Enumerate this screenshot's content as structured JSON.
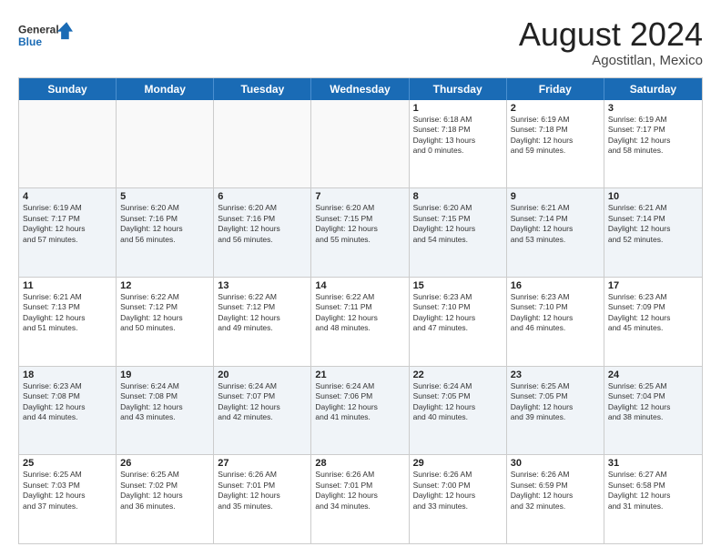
{
  "header": {
    "logo_general": "General",
    "logo_blue": "Blue",
    "month_year": "August 2024",
    "location": "Agostitlan, Mexico"
  },
  "days_of_week": [
    "Sunday",
    "Monday",
    "Tuesday",
    "Wednesday",
    "Thursday",
    "Friday",
    "Saturday"
  ],
  "weeks": [
    [
      {
        "day": "",
        "info": ""
      },
      {
        "day": "",
        "info": ""
      },
      {
        "day": "",
        "info": ""
      },
      {
        "day": "",
        "info": ""
      },
      {
        "day": "1",
        "info": "Sunrise: 6:18 AM\nSunset: 7:18 PM\nDaylight: 13 hours\nand 0 minutes."
      },
      {
        "day": "2",
        "info": "Sunrise: 6:19 AM\nSunset: 7:18 PM\nDaylight: 12 hours\nand 59 minutes."
      },
      {
        "day": "3",
        "info": "Sunrise: 6:19 AM\nSunset: 7:17 PM\nDaylight: 12 hours\nand 58 minutes."
      }
    ],
    [
      {
        "day": "4",
        "info": "Sunrise: 6:19 AM\nSunset: 7:17 PM\nDaylight: 12 hours\nand 57 minutes."
      },
      {
        "day": "5",
        "info": "Sunrise: 6:20 AM\nSunset: 7:16 PM\nDaylight: 12 hours\nand 56 minutes."
      },
      {
        "day": "6",
        "info": "Sunrise: 6:20 AM\nSunset: 7:16 PM\nDaylight: 12 hours\nand 56 minutes."
      },
      {
        "day": "7",
        "info": "Sunrise: 6:20 AM\nSunset: 7:15 PM\nDaylight: 12 hours\nand 55 minutes."
      },
      {
        "day": "8",
        "info": "Sunrise: 6:20 AM\nSunset: 7:15 PM\nDaylight: 12 hours\nand 54 minutes."
      },
      {
        "day": "9",
        "info": "Sunrise: 6:21 AM\nSunset: 7:14 PM\nDaylight: 12 hours\nand 53 minutes."
      },
      {
        "day": "10",
        "info": "Sunrise: 6:21 AM\nSunset: 7:14 PM\nDaylight: 12 hours\nand 52 minutes."
      }
    ],
    [
      {
        "day": "11",
        "info": "Sunrise: 6:21 AM\nSunset: 7:13 PM\nDaylight: 12 hours\nand 51 minutes."
      },
      {
        "day": "12",
        "info": "Sunrise: 6:22 AM\nSunset: 7:12 PM\nDaylight: 12 hours\nand 50 minutes."
      },
      {
        "day": "13",
        "info": "Sunrise: 6:22 AM\nSunset: 7:12 PM\nDaylight: 12 hours\nand 49 minutes."
      },
      {
        "day": "14",
        "info": "Sunrise: 6:22 AM\nSunset: 7:11 PM\nDaylight: 12 hours\nand 48 minutes."
      },
      {
        "day": "15",
        "info": "Sunrise: 6:23 AM\nSunset: 7:10 PM\nDaylight: 12 hours\nand 47 minutes."
      },
      {
        "day": "16",
        "info": "Sunrise: 6:23 AM\nSunset: 7:10 PM\nDaylight: 12 hours\nand 46 minutes."
      },
      {
        "day": "17",
        "info": "Sunrise: 6:23 AM\nSunset: 7:09 PM\nDaylight: 12 hours\nand 45 minutes."
      }
    ],
    [
      {
        "day": "18",
        "info": "Sunrise: 6:23 AM\nSunset: 7:08 PM\nDaylight: 12 hours\nand 44 minutes."
      },
      {
        "day": "19",
        "info": "Sunrise: 6:24 AM\nSunset: 7:08 PM\nDaylight: 12 hours\nand 43 minutes."
      },
      {
        "day": "20",
        "info": "Sunrise: 6:24 AM\nSunset: 7:07 PM\nDaylight: 12 hours\nand 42 minutes."
      },
      {
        "day": "21",
        "info": "Sunrise: 6:24 AM\nSunset: 7:06 PM\nDaylight: 12 hours\nand 41 minutes."
      },
      {
        "day": "22",
        "info": "Sunrise: 6:24 AM\nSunset: 7:05 PM\nDaylight: 12 hours\nand 40 minutes."
      },
      {
        "day": "23",
        "info": "Sunrise: 6:25 AM\nSunset: 7:05 PM\nDaylight: 12 hours\nand 39 minutes."
      },
      {
        "day": "24",
        "info": "Sunrise: 6:25 AM\nSunset: 7:04 PM\nDaylight: 12 hours\nand 38 minutes."
      }
    ],
    [
      {
        "day": "25",
        "info": "Sunrise: 6:25 AM\nSunset: 7:03 PM\nDaylight: 12 hours\nand 37 minutes."
      },
      {
        "day": "26",
        "info": "Sunrise: 6:25 AM\nSunset: 7:02 PM\nDaylight: 12 hours\nand 36 minutes."
      },
      {
        "day": "27",
        "info": "Sunrise: 6:26 AM\nSunset: 7:01 PM\nDaylight: 12 hours\nand 35 minutes."
      },
      {
        "day": "28",
        "info": "Sunrise: 6:26 AM\nSunset: 7:01 PM\nDaylight: 12 hours\nand 34 minutes."
      },
      {
        "day": "29",
        "info": "Sunrise: 6:26 AM\nSunset: 7:00 PM\nDaylight: 12 hours\nand 33 minutes."
      },
      {
        "day": "30",
        "info": "Sunrise: 6:26 AM\nSunset: 6:59 PM\nDaylight: 12 hours\nand 32 minutes."
      },
      {
        "day": "31",
        "info": "Sunrise: 6:27 AM\nSunset: 6:58 PM\nDaylight: 12 hours\nand 31 minutes."
      }
    ]
  ]
}
